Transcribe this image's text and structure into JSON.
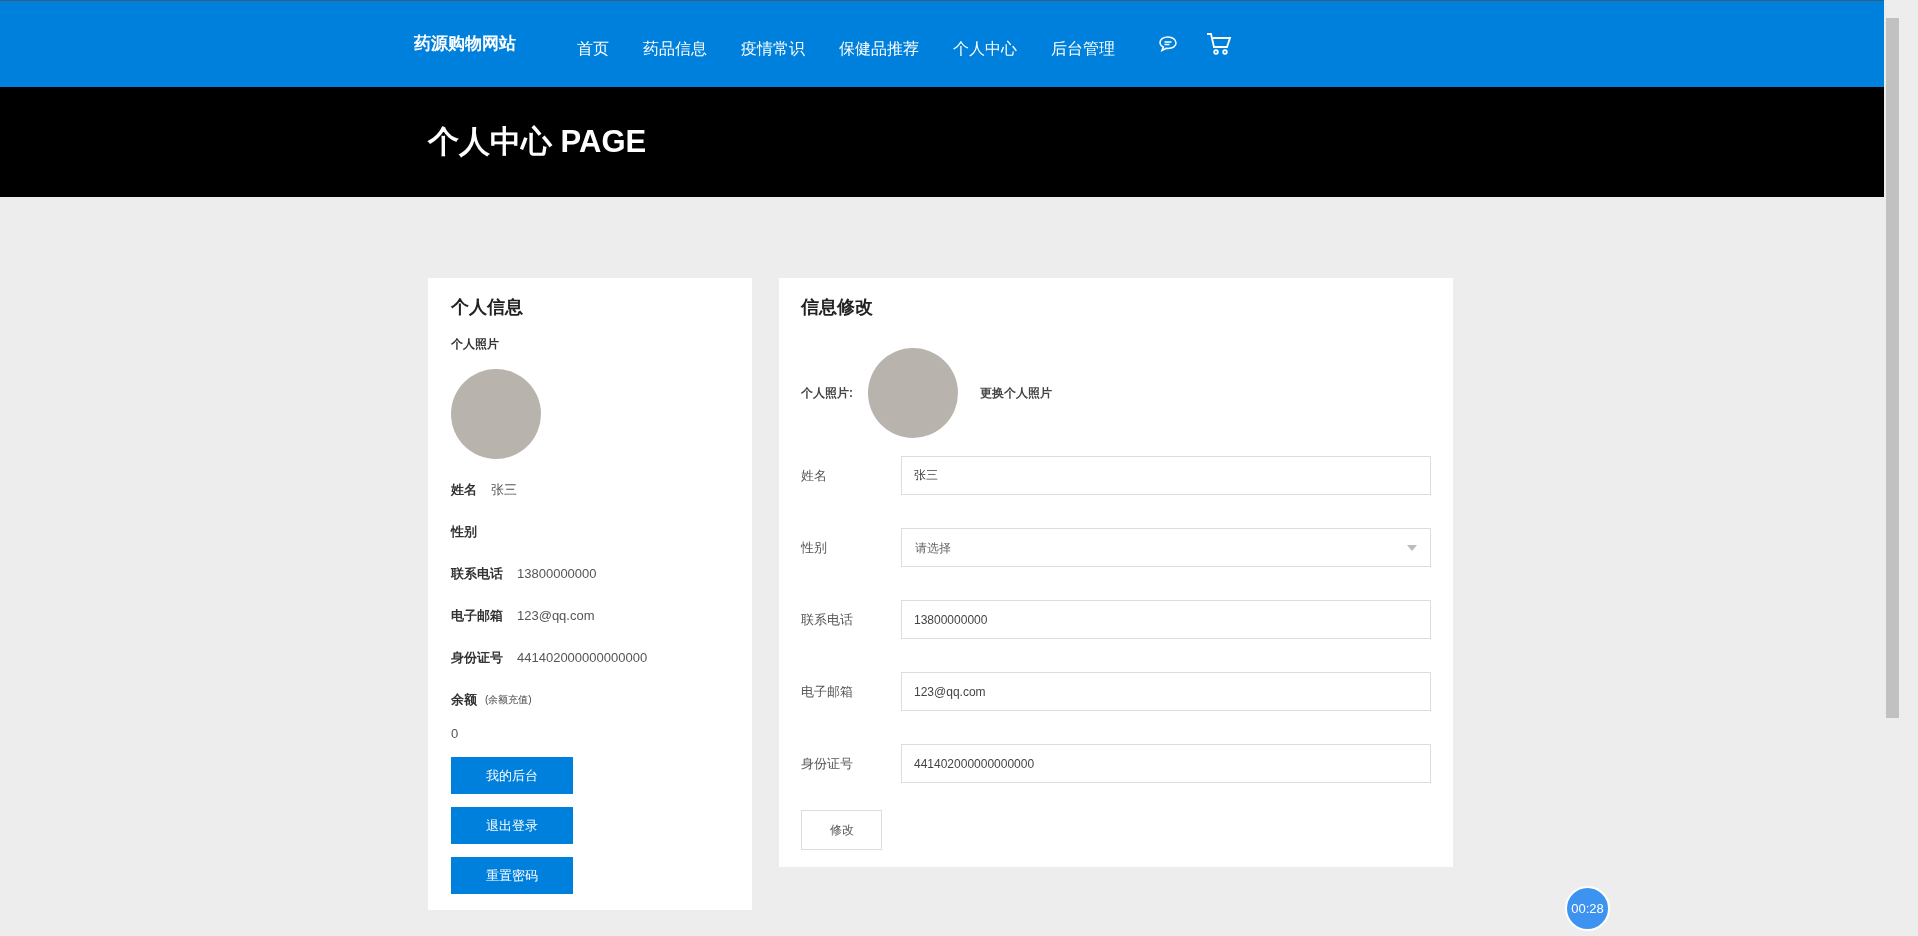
{
  "header": {
    "logo": "药源购物网站",
    "nav": [
      {
        "label": "首页",
        "selected": false
      },
      {
        "label": "药品信息",
        "selected": false
      },
      {
        "label": "疫情常识",
        "selected": false
      },
      {
        "label": "保健品推荐",
        "selected": false
      },
      {
        "label": "个人中心",
        "selected": false
      },
      {
        "label": "后台管理",
        "selected": false
      }
    ]
  },
  "banner": {
    "title": "个人中心 PAGE"
  },
  "profile_card": {
    "title": "个人信息",
    "photo_label": "个人照片",
    "fields": [
      {
        "label": "姓名",
        "value": "张三"
      },
      {
        "label": "性别"
      },
      {
        "label": "联系电话",
        "value": "13800000000"
      },
      {
        "label": "电子邮箱",
        "value": "123@qq.com"
      },
      {
        "label": "身份证号",
        "value": "441402000000000000"
      }
    ],
    "balance_label": "余额",
    "recharge_link": "(余额充值)",
    "balance": "0",
    "buttons": [
      "我的后台",
      "退出登录",
      "重置密码"
    ]
  },
  "edit_card": {
    "title": "信息修改",
    "photo_label": "个人照片:",
    "change_photo": "更换个人照片",
    "fields": [
      {
        "kind": "text",
        "label": "姓名",
        "value": "张三"
      },
      {
        "kind": "select",
        "label": "性别",
        "placeholder": "请选择"
      },
      {
        "kind": "text",
        "label": "联系电话",
        "value": "13800000000"
      },
      {
        "kind": "text",
        "label": "电子邮箱",
        "value": "123@qq.com"
      },
      {
        "kind": "text",
        "label": "身份证号",
        "value": "441402000000000000"
      }
    ],
    "submit": "修改"
  },
  "timer": "00:28"
}
